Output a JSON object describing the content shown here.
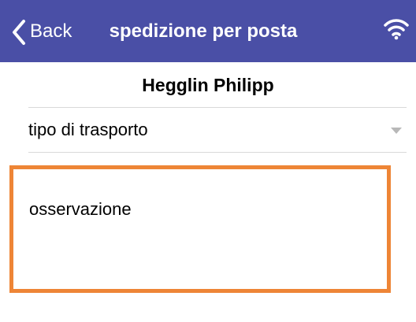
{
  "navbar": {
    "back_label": "Back",
    "title": "spedizione per posta",
    "back_icon": "chevron-left-icon",
    "status_icon": "wifi-icon",
    "background_color": "#4a4fa6"
  },
  "header": {
    "person_name": "Hegglin Philipp"
  },
  "form": {
    "transport_select_label": "tipo di trasporto",
    "transport_select_icon": "chevron-down-icon",
    "notes_placeholder": "osservazione",
    "highlight_color": "#ee8536"
  }
}
